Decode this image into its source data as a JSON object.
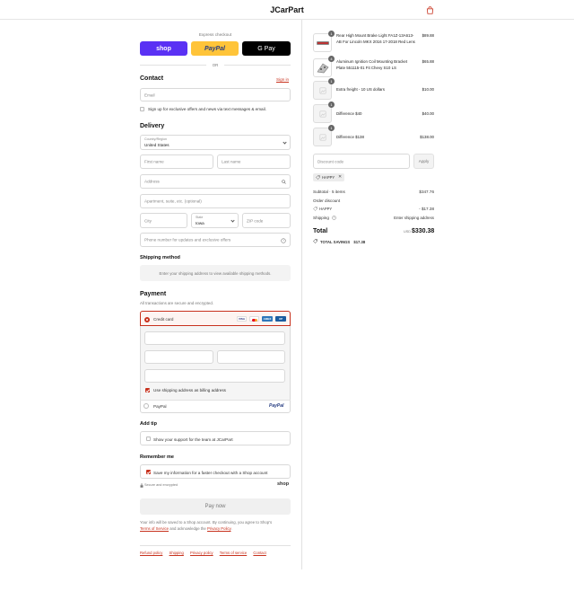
{
  "header": {
    "store_name": "JCarPart"
  },
  "express": {
    "title": "Express checkout",
    "shop_label": "shop",
    "paypal_label": "PayPal",
    "gpay_label": "G Pay",
    "or_label": "OR"
  },
  "contact": {
    "heading": "Contact",
    "sign_in": "Sign in",
    "email_placeholder": "Email",
    "offers_label": "Sign up for exclusive offers and news via text messages & email."
  },
  "delivery": {
    "heading": "Delivery",
    "country_label": "Country/Region",
    "country_value": "United States",
    "first_name": "First name",
    "last_name": "Last name",
    "address": "Address",
    "apartment": "Apartment, suite, etc. (optional)",
    "city": "City",
    "state_label": "State",
    "state_value": "Iowa",
    "zip": "ZIP code",
    "phone": "Phone number for updates and exclusive offers"
  },
  "shipping_method": {
    "heading": "Shipping method",
    "notice": "Enter your shipping address to view available shipping methods."
  },
  "payment": {
    "heading": "Payment",
    "subtitle": "All transactions are secure and encrypted.",
    "credit_card_label": "Credit card",
    "cards": [
      "VISA",
      "MC",
      "AMEX",
      "UP"
    ],
    "billing_label": "Use shipping address as billing address",
    "paypal_label": "PayPal",
    "paypal_logo": "PayPal"
  },
  "tip": {
    "heading": "Add tip",
    "label": "Show your support for the team at JCarPart"
  },
  "remember": {
    "heading": "Remember me",
    "label": "Save my information for a faster checkout with a Shop account",
    "secure_label": "Secure and encrypted",
    "shop_logo": "shop"
  },
  "pay_button": "Pay now",
  "legal": {
    "line1": "Your info will be saved to a Shop account. By continuing, you agree to Shop's",
    "terms": "Terms of Service",
    "and_ack": "and acknowledge the",
    "privacy": "Privacy Policy",
    "period": "."
  },
  "footer_links": [
    "Refund policy",
    "Shipping",
    "Privacy policy",
    "Terms of service",
    "Contact"
  ],
  "order": {
    "items": [
      {
        "qty": "1",
        "name": "Rear High Mount Brake Light FA1Z-13A613-AB For Lincoln MKX 2016 17-2018 Red Lens",
        "price": "$89.88"
      },
      {
        "qty": "4",
        "name": "Aluminum Ignition Coil Mounting Bracket Plate 551115-01 Fit Chevy S10 LS",
        "price": "$65.88"
      },
      {
        "qty": "1",
        "name": "Extra freight - 10 US dollars",
        "price": "$10.00"
      },
      {
        "qty": "1",
        "name": "Difference $40",
        "price": "$40.00"
      },
      {
        "qty": "1",
        "name": "Difference $138",
        "price": "$138.00"
      }
    ],
    "discount_placeholder": "Discount code",
    "apply_label": "Apply",
    "discount_tag": "HAPPY",
    "subtotal_label": "Subtotal · 5 items",
    "subtotal_value": "$347.76",
    "order_discount_label": "Order discount",
    "discount_code": "HAPPY",
    "discount_value": "- $17.38",
    "shipping_label": "Shipping",
    "shipping_value": "Enter shipping address",
    "total_label": "Total",
    "currency": "USD",
    "total_value": "$330.38",
    "savings_label": "TOTAL SAVINGS",
    "savings_value": "$17.38"
  },
  "colors": {
    "accent": "#c8321e",
    "shop_purple": "#5a31f4",
    "paypal_yellow": "#ffc439"
  }
}
